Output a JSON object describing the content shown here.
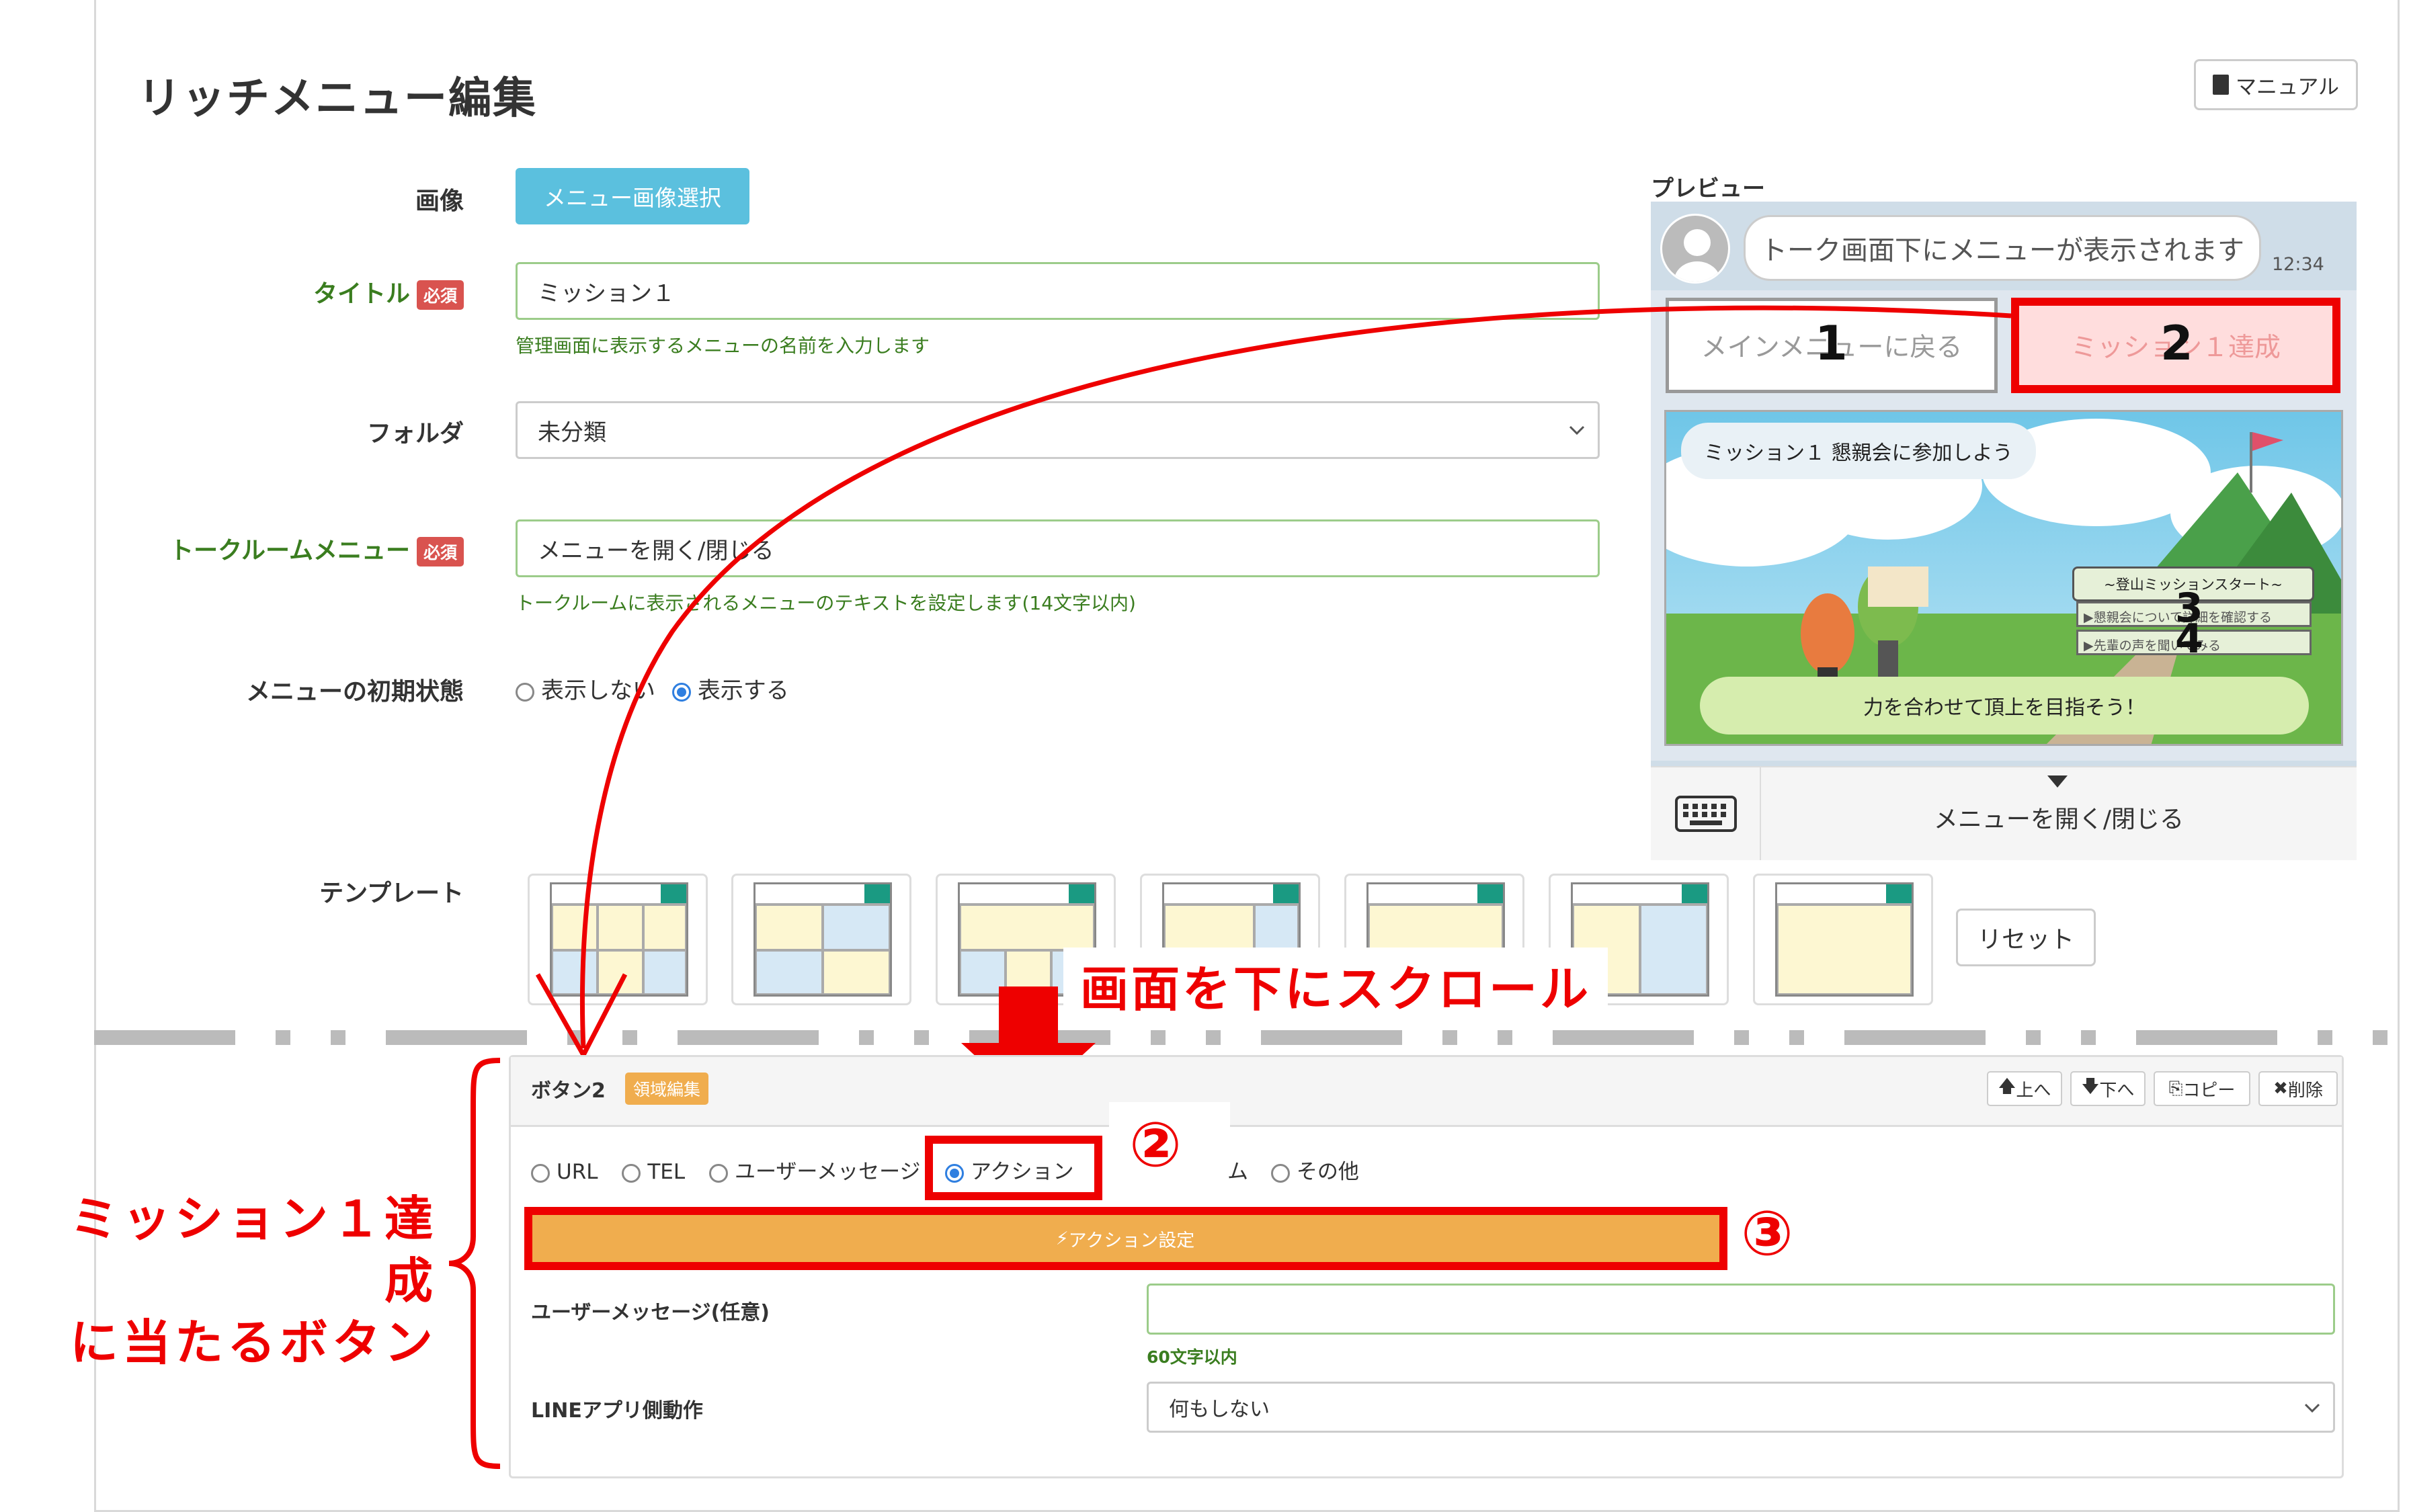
{
  "page": {
    "title": "リッチメニュー編集",
    "manual_label": "マニュアル"
  },
  "form": {
    "image_label": "画像",
    "image_button": "メニュー画像選択",
    "title_label": "タイトル",
    "required": "必須",
    "title_value": "ミッション１",
    "title_help": "管理画面に表示するメニューの名前を入力します",
    "folder_label": "フォルダ",
    "folder_value": "未分類",
    "talk_label": "トークルームメニュー",
    "talk_value": "メニューを開く/閉じる",
    "talk_help": "トークルームに表示されるメニューのテキストを設定します(14文字以内)",
    "initial_label": "メニューの初期状態",
    "initial_opt_hide": "表示しない",
    "initial_opt_show": "表示する",
    "template_label": "テンプレート",
    "reset_label": "リセット"
  },
  "preview": {
    "label": "プレビュー",
    "bubble_text": "トーク画面下にメニューが表示されます",
    "time": "12:34",
    "btn1": "メインメニューに戻る",
    "btn2": "ミッション１達成",
    "illus_title": "ミッション１ 懇親会に参加しよう",
    "illus_start": "~登山ミッションスタート~",
    "illus_item1": "▶懇親会について詳細を確認する",
    "illus_item2": "▶先輩の声を聞いてみる",
    "illus_bottom": "力を合わせて頂上を目指そう！",
    "footer_text": "メニューを開く/閉じる",
    "num1": "1",
    "num2": "2",
    "num3": "3",
    "num4": "4"
  },
  "annotations": {
    "scroll": "画面を下にスクロール",
    "circle2": "②",
    "circle3": "③",
    "side_line1": "ミッション１達成",
    "side_line2": "に当たるボタン"
  },
  "panel": {
    "title": "ボタン2",
    "area_edit": "領域編集",
    "up": "上へ",
    "down": "下へ",
    "copy": "コピー",
    "delete": "削除",
    "type_url": "URL",
    "type_tel": "TEL",
    "type_user": "ユーザーメッセージ",
    "type_action": "アクション",
    "type_form_tail": "ム",
    "type_other": "その他",
    "action_setting": "アクション設定",
    "user_msg_label": "ユーザーメッセージ(任意)",
    "user_msg_help": "60文字以内",
    "line_label": "LINEアプリ側動作",
    "line_value": "何もしない"
  },
  "colors": {
    "accent_red": "#e00000",
    "info_blue": "#5bc0de",
    "warn_orange": "#f0ad4e",
    "green_label": "#3a7d1f"
  }
}
